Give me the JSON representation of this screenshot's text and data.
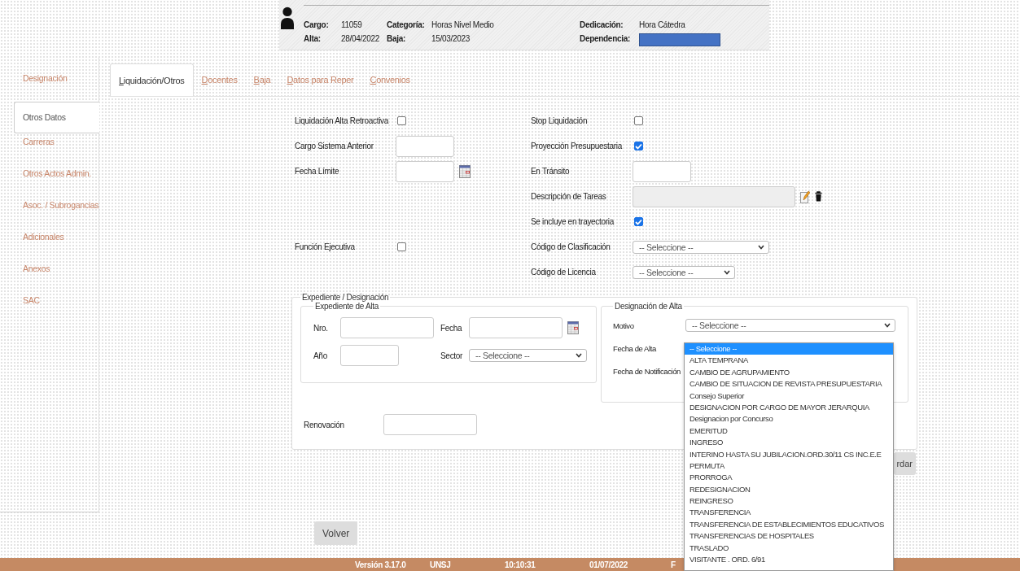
{
  "header": {
    "fields": [
      {
        "label": "Cargo:",
        "value": "11059"
      },
      {
        "label": "Categoría:",
        "value": "Horas Nivel Medio"
      },
      {
        "label": "Dedicación:",
        "value": "Hora Cátedra"
      },
      {
        "label": "Alta:",
        "value": "28/04/2022"
      },
      {
        "label": "Baja:",
        "value": "15/03/2023"
      },
      {
        "label": "Dependencia:",
        "redacted": true
      }
    ]
  },
  "sidebar": {
    "items": [
      {
        "label": "Designación",
        "selected": false
      },
      {
        "label": "Otros Datos",
        "selected": true
      },
      {
        "label": "Carreras",
        "selected": false
      },
      {
        "label": "Otros Actos Admin.",
        "selected": false
      },
      {
        "label": "Asoc. / Subrogancias",
        "selected": false
      },
      {
        "label": "Adicionales",
        "selected": false
      },
      {
        "label": "Anexos",
        "selected": false
      },
      {
        "label": "SAC",
        "selected": false
      }
    ]
  },
  "tabs": [
    {
      "label": "Liquidación/Otros",
      "selected": true
    },
    {
      "label": "Docentes",
      "selected": false
    },
    {
      "label": "Baja",
      "selected": false
    },
    {
      "label": "Datos para Reper",
      "selected": false
    },
    {
      "label": "Convenios",
      "selected": false
    }
  ],
  "form": {
    "rows": [
      {
        "left": {
          "label": "Liquidación Alta Retroactiva",
          "kind": "checkbox",
          "checked": false
        },
        "right": {
          "label": "Stop Liquidación",
          "kind": "checkbox",
          "checked": false
        }
      },
      {
        "left": {
          "label": "Cargo Sistema Anterior",
          "kind": "text"
        },
        "right": {
          "label": "Proyección Presupuestaria",
          "kind": "checkbox",
          "checked": true
        }
      },
      {
        "left": {
          "label": "Fecha Límite",
          "kind": "date"
        },
        "right": {
          "label": "En Tránsito",
          "kind": "text"
        }
      },
      {
        "right": {
          "label": "Descripción de Tareas",
          "kind": "description"
        }
      },
      {
        "right": {
          "label": "Se incluye en trayectoria",
          "kind": "checkbox",
          "checked": true
        }
      },
      {
        "left": {
          "label": "Función Ejecutiva",
          "kind": "checkbox",
          "checked": false
        },
        "right": {
          "label": "Código de Clasificación",
          "kind": "select",
          "value": "-- Seleccione --"
        }
      },
      {
        "right": {
          "label": "Código de Licencia",
          "kind": "select",
          "value": "-- Seleccione --"
        }
      }
    ]
  },
  "expediente": {
    "title": "Expediente / Designación",
    "alta": {
      "title": "Expediente de Alta",
      "fields": [
        {
          "label": "Nro.",
          "kind": "text"
        },
        {
          "label": "Fecha",
          "kind": "date"
        },
        {
          "label": "Año",
          "kind": "text"
        },
        {
          "label": "Sector",
          "kind": "select",
          "value": "-- Seleccione --"
        }
      ]
    },
    "designacion": {
      "title": "Designación de Alta",
      "fields": [
        {
          "label": "Motivo",
          "kind": "select",
          "value": "-- Seleccione --"
        },
        {
          "label": "Fecha de Alta"
        },
        {
          "label": "Fecha de Notificación"
        }
      ]
    },
    "renovacion": {
      "label": "Renovación"
    }
  },
  "dropdown": {
    "options": [
      {
        "label": "-- Seleccione --",
        "selected": true
      },
      {
        "label": "ALTA TEMPRANA",
        "selected": false
      },
      {
        "label": "CAMBIO DE AGRUPAMIENTO",
        "selected": false
      },
      {
        "label": "CAMBIO DE SITUACION DE REVISTA PRESUPUESTARIA",
        "selected": false
      },
      {
        "label": "Consejo Superior",
        "selected": false
      },
      {
        "label": "DESIGNACION POR CARGO DE MAYOR JERARQUIA",
        "selected": false
      },
      {
        "label": "Designacion por Concurso",
        "selected": false
      },
      {
        "label": "EMERITUD",
        "selected": false
      },
      {
        "label": "INGRESO",
        "selected": false
      },
      {
        "label": "INTERINO HASTA SU JUBILACION.ORD.30/11 CS INC.E.E",
        "selected": false
      },
      {
        "label": "PERMUTA",
        "selected": false
      },
      {
        "label": "PRORROGA",
        "selected": false
      },
      {
        "label": "REDESIGNACION",
        "selected": false
      },
      {
        "label": "REINGRESO",
        "selected": false
      },
      {
        "label": "TRANSFERENCIA",
        "selected": false
      },
      {
        "label": "TRANSFERENCIA DE ESTABLECIMIENTOS EDUCATIVOS",
        "selected": false
      },
      {
        "label": "TRANSFERENCIAS DE HOSPITALES",
        "selected": false
      },
      {
        "label": "TRASLADO",
        "selected": false
      },
      {
        "label": "VISITANTE . ORD. 6/91",
        "selected": false
      }
    ]
  },
  "buttons": {
    "save": "rdar",
    "back": "Volver"
  },
  "footer": {
    "items": [
      "Versión 3.17.0",
      "UNSJ",
      "10:10:31",
      "01/07/2022",
      "F"
    ]
  }
}
